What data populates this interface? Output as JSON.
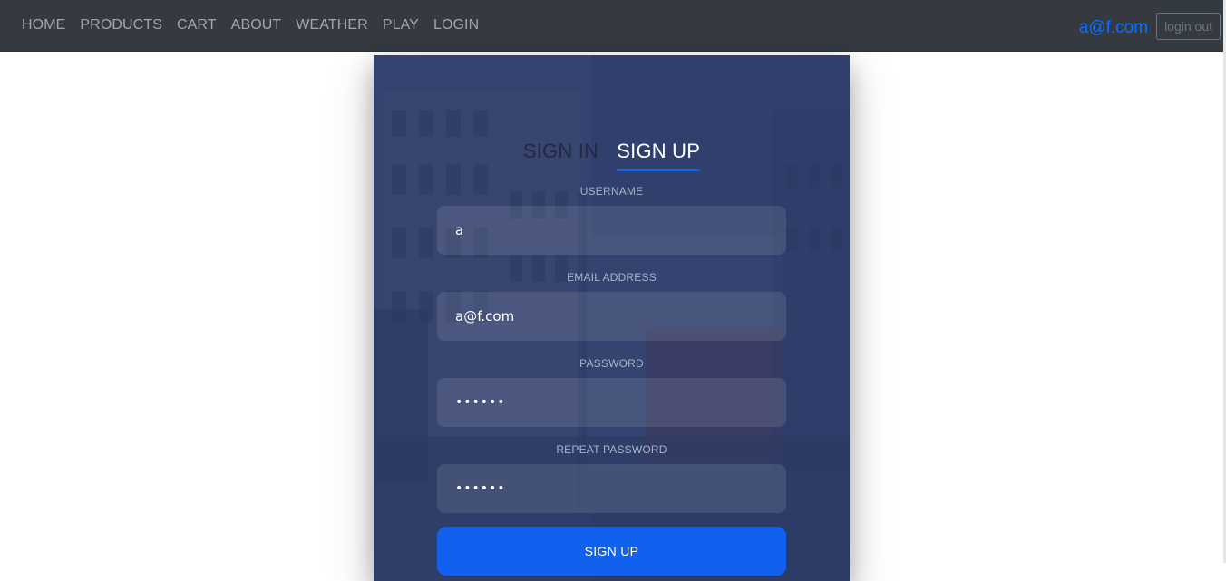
{
  "nav": {
    "links": [
      "HOME",
      "PRODUCTS",
      "CART",
      "ABOUT",
      "WEATHER",
      "PLAY",
      "LOGIN"
    ],
    "user_email": "a@f.com",
    "logout_label": "login out"
  },
  "form": {
    "tabs": {
      "sign_in": "SIGN IN",
      "sign_up": "SIGN UP",
      "active": "SIGN UP"
    },
    "username": {
      "label": "USERNAME",
      "value": "a"
    },
    "email": {
      "label": "EMAIL ADDRESS",
      "value": "a@f.com"
    },
    "password": {
      "label": "PASSWORD",
      "value": "••••••"
    },
    "repeat_password": {
      "label": "REPEAT PASSWORD",
      "value": "••••••"
    },
    "submit_label": "SIGN UP"
  },
  "colors": {
    "navbar_bg": "#343a40",
    "accent": "#1161ee",
    "link_blue": "#0d6efd",
    "card_overlay": "#283965"
  }
}
